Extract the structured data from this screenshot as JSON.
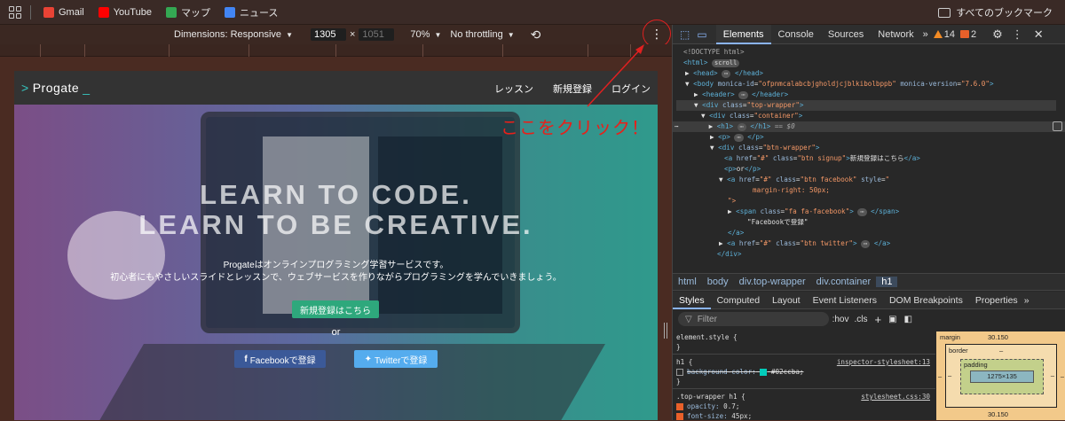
{
  "bookmarks": {
    "items": [
      {
        "label": "Gmail",
        "color": "#e94335"
      },
      {
        "label": "YouTube",
        "color": "#ff0000"
      },
      {
        "label": "マップ",
        "color": "#34a853"
      },
      {
        "label": "ニュース",
        "color": "#4285f4"
      }
    ],
    "all": "すべてのブックマーク"
  },
  "device_toolbar": {
    "dimensions": "Dimensions: Responsive",
    "width": "1305",
    "height": "1051",
    "zoom": "70%",
    "throttle": "No throttling",
    "x": "×"
  },
  "site": {
    "logo": "Progate",
    "nav": [
      "レッスン",
      "新規登録",
      "ログイン"
    ],
    "h1_line1": "LEARN TO CODE.",
    "h1_line2": "LEARN TO BE CREATIVE.",
    "desc1": "Progateはオンラインプログラミング学習サービスです。",
    "desc2": "初心者にもやさしいスライドとレッスンで、ウェブサービスを作りながらプログラミングを学んでいきましょう。",
    "signup": "新規登録はこちら",
    "or": "or",
    "facebook": "Facebookで登録",
    "twitter": "Twitterで登録"
  },
  "annotation": "ここをクリック！",
  "devtools": {
    "tabs": [
      "Elements",
      "Console",
      "Sources",
      "Network"
    ],
    "warnings": "14",
    "messages": "2",
    "dom": {
      "doctype": "<!DOCTYPE html>",
      "scroll": "scroll",
      "eq": "== $0",
      "fb_text": "\"Facebookで登録\"",
      "signup_text": "新規登録はこちら",
      "or_text": "or",
      "margin": "margin-right: 50px;",
      "quote": "\">"
    },
    "breadcrumbs": [
      "html",
      "body",
      "div.top-wrapper",
      "div.container",
      "h1"
    ],
    "styles_tabs": [
      "Styles",
      "Computed",
      "Layout",
      "Event Listeners",
      "DOM Breakpoints",
      "Properties"
    ],
    "filter": "Filter",
    "hov": ":hov",
    ".cls": ".cls",
    "rules": {
      "element_style": "element.style {",
      "close": "}",
      "h1": "h1 {",
      "ua_src": "inspector-stylesheet:13",
      "bg_prop": "background-color:",
      "bg_val": "#02ccba;",
      "tw": ".top-wrapper h1 {",
      "tw_src": "stylesheet.css:30",
      "op_prop": "opacity:",
      "op_val": "0.7;",
      "fs_prop": "font-size:",
      "fs_val": "45px;"
    },
    "boxmodel": {
      "margin_label": "margin",
      "margin_val": "30.150",
      "border_label": "border",
      "border_val": "–",
      "padding_label": "padding",
      "padding_val": "–",
      "content": "1275×135",
      "bottom_val": "30.150",
      "side": "–"
    }
  }
}
